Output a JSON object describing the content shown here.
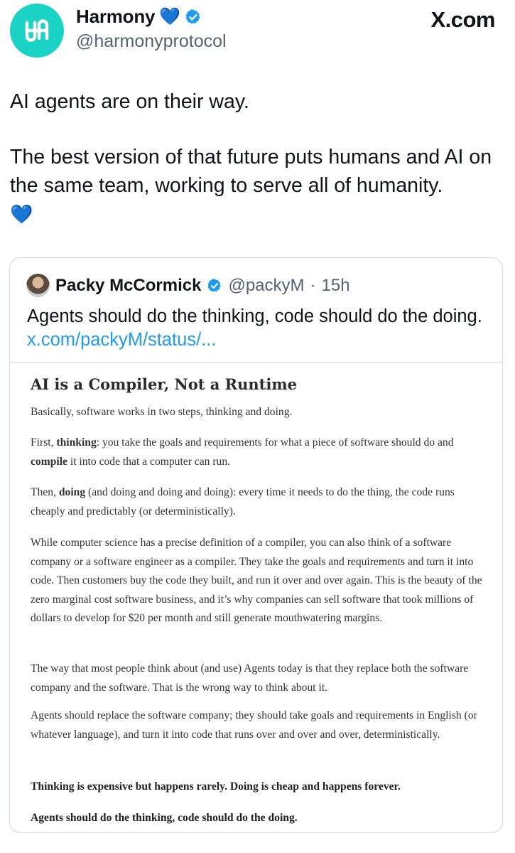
{
  "header": {
    "name": "Harmony",
    "name_emoji": "💙",
    "handle": "@harmonyprotocol",
    "brand": "X.com",
    "avatar_color": "#1bd3c4",
    "verified_color": "#1d9bf0"
  },
  "tweet": {
    "line1": "AI agents are on their way.",
    "line2": "The best version of that future puts humans and AI on the same team, working to serve all of humanity.",
    "emoji": "💙"
  },
  "quote": {
    "name": "Packy McCormick",
    "handle": "@packyM",
    "separator": "·",
    "time": "15h",
    "text": "Agents should do the thinking, code should do the doing.",
    "link": "x.com/packyM/status/...",
    "link_color": "#1d9bf0"
  },
  "article": {
    "title": "AI is a Compiler, Not a Runtime",
    "p1": "Basically, software works in two steps, thinking and doing.",
    "p2": {
      "pre": "First, ",
      "b1": "thinking",
      "mid": ": you take the goals and requirements for what a piece of software should do and ",
      "b2": "compile",
      "post": " it into code that a computer can run."
    },
    "p3": {
      "pre": "Then, ",
      "b1": "doing",
      "post": " (and doing and doing and doing): every time it needs to do the thing, the code runs cheaply and predictably (or deterministically)."
    },
    "p4": "While computer science has a precise definition of a compiler, you can also think of a software company or a software engineer as a compiler. They take the goals and requirements and turn it into code. Then customers buy the code they built, and run it over and over again. This is the beauty of the zero marginal cost software business, and it’s why companies can sell software that took millions of dollars to develop for $20 per month and still generate mouthwatering margins.",
    "p5": "The way that most people think about (and use) Agents today is that they replace both the software company and the software. That is the wrong way to think about it.",
    "p6": "Agents should replace the software company; they should take goals and requirements in English (or whatever language), and turn it into code that runs over and over and over, deterministically.",
    "p7": "Thinking is expensive but happens rarely. Doing is cheap and happens forever.",
    "p8": "Agents should do the thinking, code should do the doing."
  }
}
